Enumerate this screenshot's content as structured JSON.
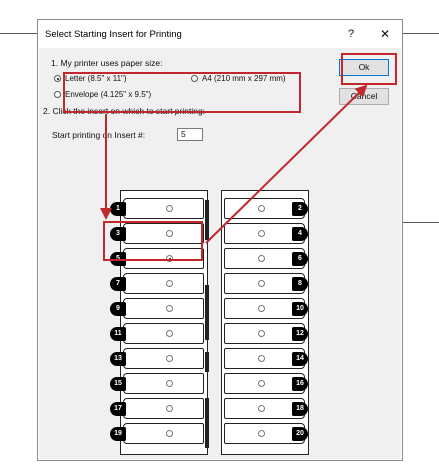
{
  "dialog": {
    "title": "Select Starting Insert for Printing",
    "help_label": "?",
    "close_label": "✕",
    "step1_label": "1. My printer uses paper size:",
    "paper_sizes": {
      "letter": "Letter (8.5\" x 11\")",
      "a4": "A4 (210 mm x 297 mm)",
      "envelope": "Envelope (4.125\" x 9.5\")"
    },
    "selected_paper": "letter",
    "ok_label": "Ok",
    "cancel_label": "Cancel",
    "step2_label": "2. Click the insert on which to start printing:",
    "start_label": "Start printing on Insert #:",
    "start_value": "5",
    "inserts_left": [
      "1",
      "3",
      "5",
      "7",
      "9",
      "11",
      "13",
      "15",
      "17",
      "19"
    ],
    "inserts_right": [
      "2",
      "4",
      "6",
      "8",
      "10",
      "12",
      "14",
      "16",
      "18",
      "20"
    ],
    "selected_insert": "5"
  },
  "colors": {
    "highlight": "#c0282d",
    "accent": "#0078d7"
  }
}
